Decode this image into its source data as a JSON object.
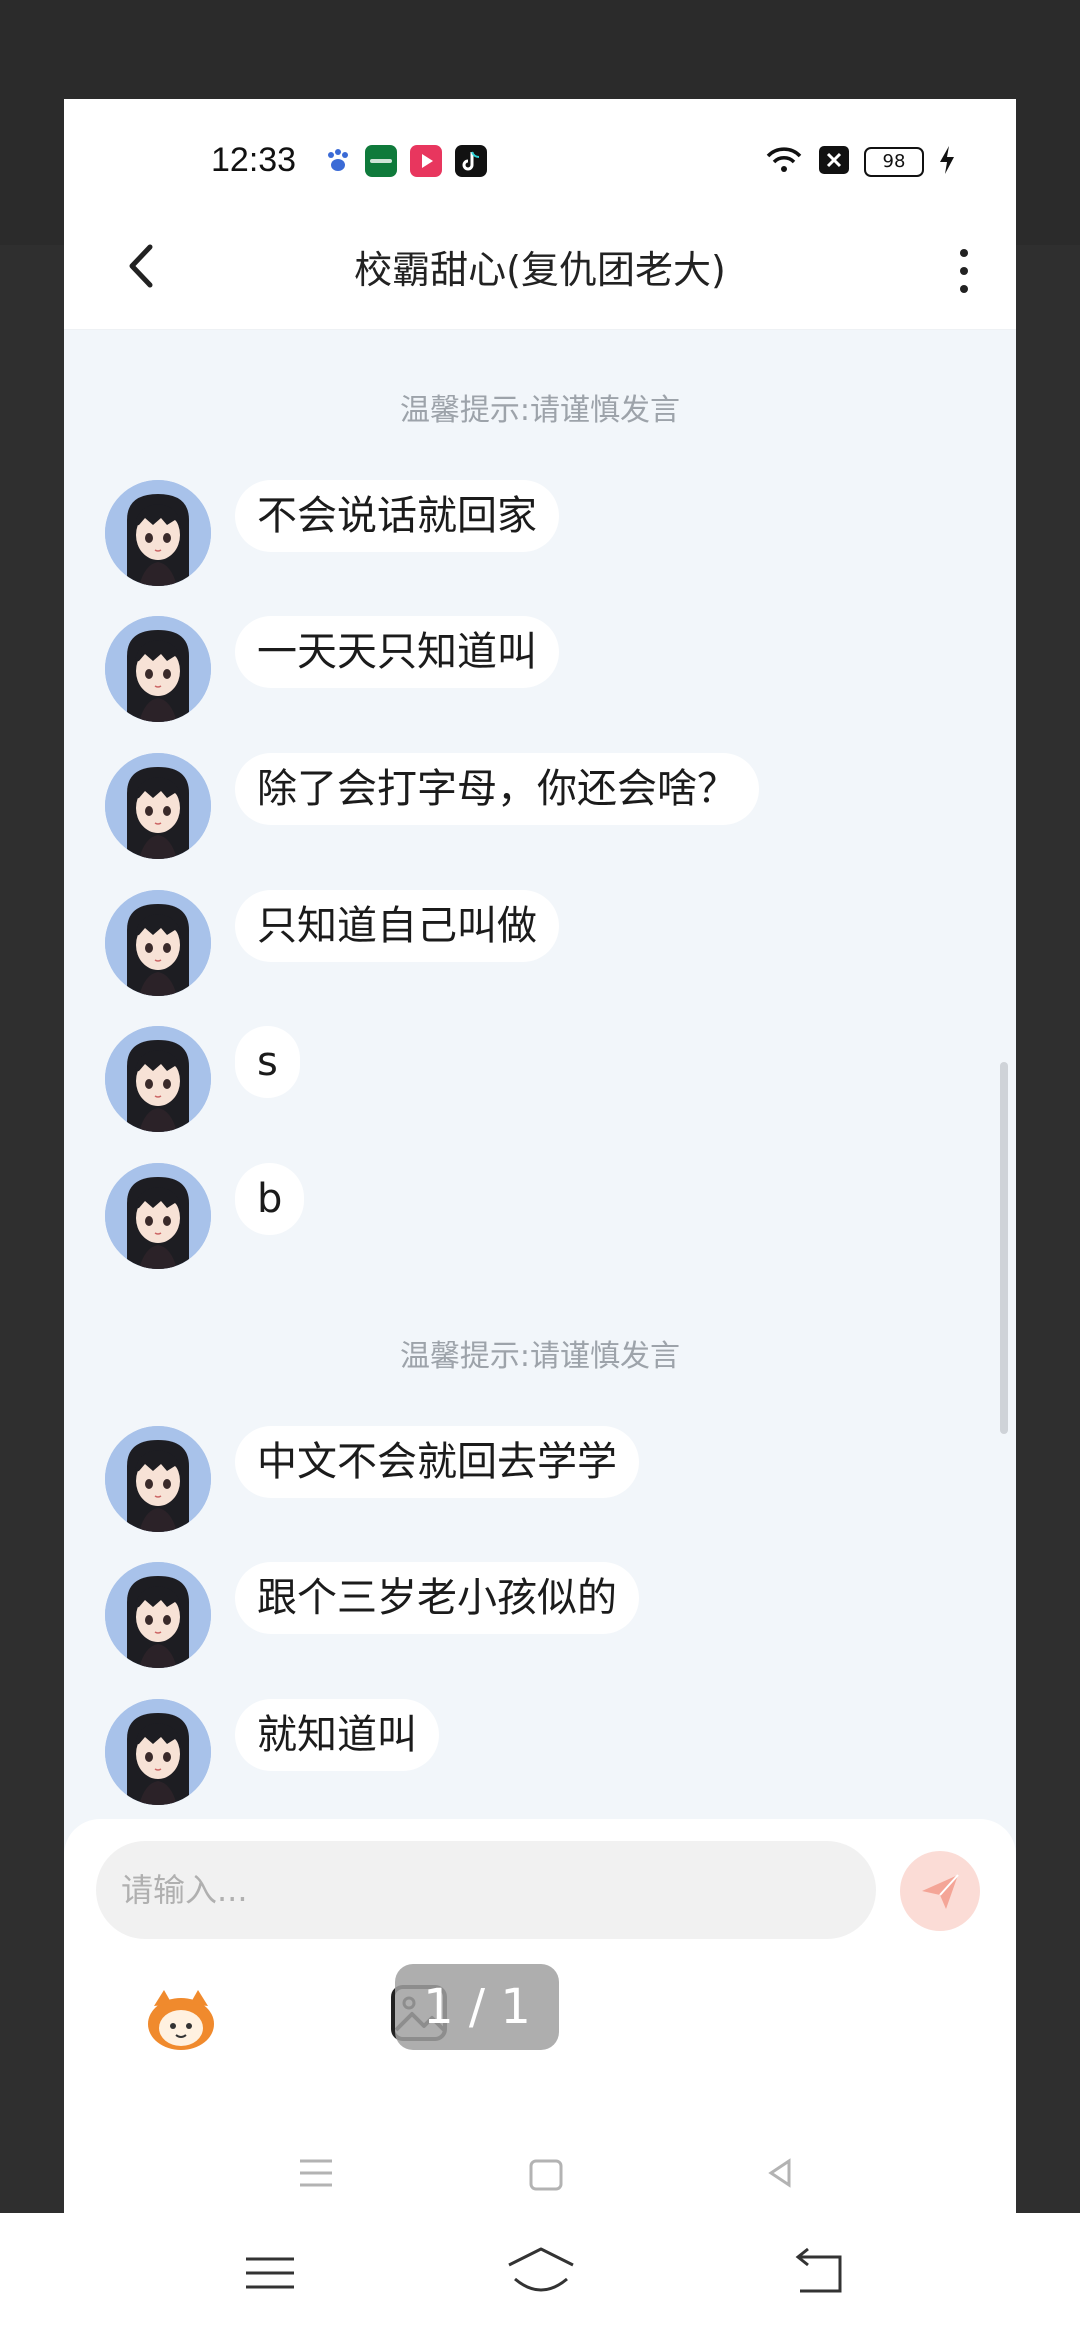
{
  "status_bar": {
    "time": "12:33",
    "battery": "98",
    "icons": [
      "baidu-icon",
      "oppo-icon",
      "video-icon",
      "tiktok-icon",
      "wifi-icon",
      "close-box-icon",
      "battery-icon",
      "charging-icon"
    ]
  },
  "header": {
    "title": "校霸甜心(复仇团老大)",
    "back_icon": "chevron-left-icon",
    "more_icon": "more-vertical-icon"
  },
  "chat": {
    "notices": [
      "温馨提示:请谨慎发言",
      "温馨提示:请谨慎发言"
    ],
    "messages": [
      {
        "text": "不会说话就回家"
      },
      {
        "text": "一天天只知道叫"
      },
      {
        "text": "除了会打字母，你还会啥？"
      },
      {
        "text": "只知道自己叫做"
      },
      {
        "text": "s"
      },
      {
        "text": "b"
      },
      {
        "text": "中文不会就回去学学"
      },
      {
        "text": "跟个三岁老小孩似的"
      },
      {
        "text": "就知道叫"
      }
    ]
  },
  "input_bar": {
    "placeholder": "请输入...",
    "send_icon": "paper-plane-icon",
    "emoji_icon": "emoji-mascot-icon",
    "image_icon": "image-icon",
    "send_color": "#f4a597"
  },
  "page_indicator": "1 / 1",
  "colors": {
    "chat_bg": "#f2f6fa",
    "bubble_bg": "#ffffff",
    "notice_text": "#9da3aa"
  }
}
